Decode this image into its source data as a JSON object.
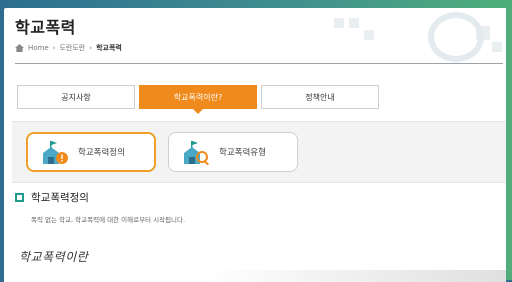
{
  "page": {
    "title": "학교폭력",
    "breadcrumb": {
      "home": "Home",
      "level1": "도란도란",
      "current": "학교폭력"
    }
  },
  "tabs": [
    {
      "label": "공지사항",
      "active": false
    },
    {
      "label": "학교폭력이란?",
      "active": true
    },
    {
      "label": "정책안내",
      "active": false
    }
  ],
  "subtabs": [
    {
      "label": "학교폭력정의",
      "icon": "school-warning-icon",
      "active": true
    },
    {
      "label": "학교폭력유형",
      "icon": "school-search-icon",
      "active": false
    }
  ],
  "section": {
    "heading": "학교폭력정의",
    "description": "폭력 없는 학교, 학교폭력에 대한 이해로부터 시작됩니다.",
    "handwritten_title": "학교폭력이란"
  },
  "colors": {
    "accent": "#f08a1d",
    "section_bullet": "#1f9a8c"
  }
}
